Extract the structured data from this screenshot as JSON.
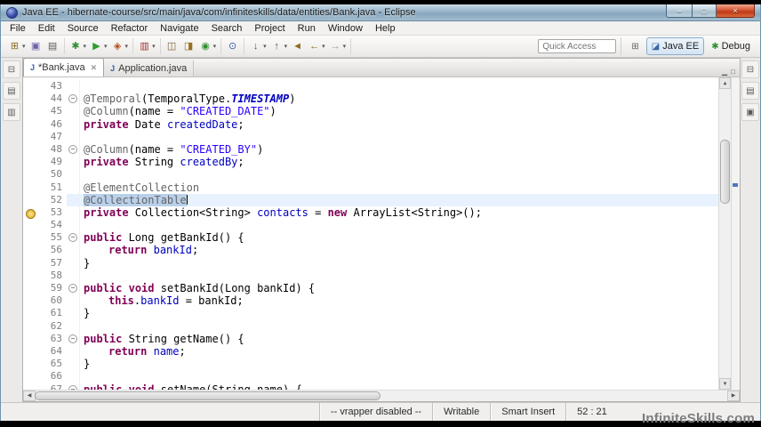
{
  "frame": {
    "watermark": "InfiniteSkills.com"
  },
  "window": {
    "title": "Java EE - hibernate-course/src/main/java/com/infiniteskills/data/entities/Bank.java - Eclipse"
  },
  "menubar": {
    "items": [
      "File",
      "Edit",
      "Source",
      "Refactor",
      "Navigate",
      "Search",
      "Project",
      "Run",
      "Window",
      "Help"
    ]
  },
  "toolbar": {
    "quick_access_placeholder": "Quick Access",
    "groups": [
      {
        "icons": [
          {
            "name": "new-wizard",
            "glyph": "⊞",
            "color": "#8a6d1f",
            "dropdown": true
          },
          {
            "name": "save",
            "glyph": "▣",
            "color": "#6f5fa8"
          },
          {
            "name": "print",
            "glyph": "▤",
            "color": "#5a5a5a"
          }
        ]
      },
      {
        "icons": [
          {
            "name": "debug",
            "glyph": "✱",
            "color": "#2f8f2f",
            "dropdown": true
          },
          {
            "name": "run",
            "glyph": "▶",
            "color": "#2f9b2f",
            "dropdown": true
          },
          {
            "name": "external-tools",
            "glyph": "◈",
            "color": "#b05020",
            "dropdown": true
          }
        ]
      },
      {
        "icons": [
          {
            "name": "coverage",
            "glyph": "▥",
            "color": "#a03030",
            "dropdown": true
          }
        ]
      },
      {
        "icons": [
          {
            "name": "new-java-project",
            "glyph": "◫",
            "color": "#7a5c30"
          },
          {
            "name": "new-package",
            "glyph": "◨",
            "color": "#9a7022"
          },
          {
            "name": "new-class",
            "glyph": "◉",
            "color": "#2f8f2f",
            "dropdown": true
          }
        ]
      },
      {
        "icons": [
          {
            "name": "search",
            "glyph": "⊙",
            "color": "#3a5fa8"
          }
        ]
      },
      {
        "icons": [
          {
            "name": "next-annotation",
            "glyph": "↓",
            "color": "#555555",
            "dropdown": true
          },
          {
            "name": "previous-annotation",
            "glyph": "↑",
            "color": "#555555",
            "dropdown": true
          },
          {
            "name": "last-edit-location",
            "glyph": "◄",
            "color": "#8a6d1f"
          },
          {
            "name": "back",
            "glyph": "←",
            "color": "#8a6d1f",
            "dropdown": true
          },
          {
            "name": "forward",
            "glyph": "→",
            "color": "#999999",
            "dropdown": true
          }
        ]
      }
    ],
    "perspectives": [
      {
        "name": "open-perspective",
        "glyph": "⊞",
        "color": "#666666",
        "active": false
      },
      {
        "name": "java-ee-perspective",
        "label": "Java EE",
        "glyph": "◪",
        "color": "#3a66a8",
        "active": true
      },
      {
        "name": "debug-perspective",
        "label": "Debug",
        "glyph": "✱",
        "color": "#2f8f2f",
        "active": false
      }
    ]
  },
  "left_rail": {
    "icons": [
      {
        "name": "restore-left-views",
        "glyph": "⊟"
      },
      {
        "name": "project-explorer-view",
        "glyph": "▤"
      },
      {
        "name": "navigator-view",
        "glyph": "▥"
      }
    ]
  },
  "right_rail": {
    "icons": [
      {
        "name": "restore-right-views",
        "glyph": "⊟"
      },
      {
        "name": "outline-view",
        "glyph": "▤"
      },
      {
        "name": "task-list-view",
        "glyph": "▣"
      }
    ]
  },
  "editor_tabs": {
    "tabs": [
      {
        "label": "*Bank.java",
        "active": true,
        "closable": true,
        "icon_glyph": "J"
      },
      {
        "label": "Application.java",
        "active": false,
        "closable": false,
        "icon_glyph": "J"
      }
    ],
    "actions": [
      {
        "name": "minimize-editor",
        "glyph": "▁"
      },
      {
        "name": "maximize-editor",
        "glyph": "□"
      }
    ]
  },
  "editor": {
    "current_line": 52,
    "lines": [
      {
        "num": 43,
        "indent": 0,
        "tokens": []
      },
      {
        "num": 44,
        "indent": 0,
        "fold": true,
        "tokens": [
          [
            "a",
            "@Temporal"
          ],
          [
            "p",
            "(TemporalType."
          ],
          [
            "si",
            "TIMESTAMP"
          ],
          [
            "p",
            ")"
          ]
        ]
      },
      {
        "num": 45,
        "indent": 0,
        "tokens": [
          [
            "a",
            "@Column"
          ],
          [
            "p",
            "(name = "
          ],
          [
            "s",
            "\"CREATED_DATE\""
          ],
          [
            "p",
            ")"
          ]
        ]
      },
      {
        "num": 46,
        "indent": 0,
        "tokens": [
          [
            "k",
            "private"
          ],
          [
            "p",
            " Date "
          ],
          [
            "f",
            "createdDate"
          ],
          [
            "p",
            ";"
          ]
        ]
      },
      {
        "num": 47,
        "indent": 0,
        "tokens": []
      },
      {
        "num": 48,
        "indent": 0,
        "fold": true,
        "tokens": [
          [
            "a",
            "@Column"
          ],
          [
            "p",
            "(name = "
          ],
          [
            "s",
            "\"CREATED_BY\""
          ],
          [
            "p",
            ")"
          ]
        ]
      },
      {
        "num": 49,
        "indent": 0,
        "tokens": [
          [
            "k",
            "private"
          ],
          [
            "p",
            " String "
          ],
          [
            "f",
            "createdBy"
          ],
          [
            "p",
            ";"
          ]
        ]
      },
      {
        "num": 50,
        "indent": 0,
        "tokens": []
      },
      {
        "num": 51,
        "indent": 0,
        "tokens": [
          [
            "a",
            "@ElementCollection"
          ]
        ]
      },
      {
        "num": 52,
        "indent": 0,
        "current": true,
        "caret": true,
        "tokens": [
          [
            "a sel",
            "@CollectionTable"
          ]
        ]
      },
      {
        "num": 53,
        "indent": 0,
        "marker": "lightbulb",
        "tokens": [
          [
            "k",
            "private"
          ],
          [
            "p",
            " Collection<String> "
          ],
          [
            "f",
            "contacts"
          ],
          [
            "p",
            " = "
          ],
          [
            "k",
            "new"
          ],
          [
            "p",
            " ArrayList<String>();"
          ]
        ]
      },
      {
        "num": 54,
        "indent": 0,
        "tokens": []
      },
      {
        "num": 55,
        "indent": 0,
        "fold": true,
        "tokens": [
          [
            "k",
            "public"
          ],
          [
            "p",
            " Long getBankId() {"
          ]
        ]
      },
      {
        "num": 56,
        "indent": 1,
        "tokens": [
          [
            "k",
            "return"
          ],
          [
            "p",
            " "
          ],
          [
            "f",
            "bankId"
          ],
          [
            "p",
            ";"
          ]
        ]
      },
      {
        "num": 57,
        "indent": 0,
        "tokens": [
          [
            "p",
            "}"
          ]
        ]
      },
      {
        "num": 58,
        "indent": 0,
        "tokens": []
      },
      {
        "num": 59,
        "indent": 0,
        "fold": true,
        "tokens": [
          [
            "k",
            "public"
          ],
          [
            "p",
            " "
          ],
          [
            "k",
            "void"
          ],
          [
            "p",
            " setBankId(Long bankId) {"
          ]
        ]
      },
      {
        "num": 60,
        "indent": 1,
        "tokens": [
          [
            "k",
            "this"
          ],
          [
            "p",
            "."
          ],
          [
            "f",
            "bankId"
          ],
          [
            "p",
            " = bankId;"
          ]
        ]
      },
      {
        "num": 61,
        "indent": 0,
        "tokens": [
          [
            "p",
            "}"
          ]
        ]
      },
      {
        "num": 62,
        "indent": 0,
        "tokens": []
      },
      {
        "num": 63,
        "indent": 0,
        "fold": true,
        "tokens": [
          [
            "k",
            "public"
          ],
          [
            "p",
            " String getName() {"
          ]
        ]
      },
      {
        "num": 64,
        "indent": 1,
        "tokens": [
          [
            "k",
            "return"
          ],
          [
            "p",
            " "
          ],
          [
            "f",
            "name"
          ],
          [
            "p",
            ";"
          ]
        ]
      },
      {
        "num": 65,
        "indent": 0,
        "tokens": [
          [
            "p",
            "}"
          ]
        ]
      },
      {
        "num": 66,
        "indent": 0,
        "tokens": []
      },
      {
        "num": 67,
        "indent": 0,
        "fold": true,
        "tokens": [
          [
            "k",
            "public"
          ],
          [
            "p",
            " "
          ],
          [
            "k",
            "void"
          ],
          [
            "p",
            " setName(String name) {"
          ]
        ]
      }
    ]
  },
  "statusbar": {
    "fields": [
      {
        "name": "vrapper-status",
        "text": "-- vrapper disabled --"
      },
      {
        "name": "write-mode",
        "text": "Writable"
      },
      {
        "name": "insert-mode",
        "text": "Smart Insert"
      },
      {
        "name": "cursor-position",
        "text": "52 : 21"
      }
    ]
  }
}
